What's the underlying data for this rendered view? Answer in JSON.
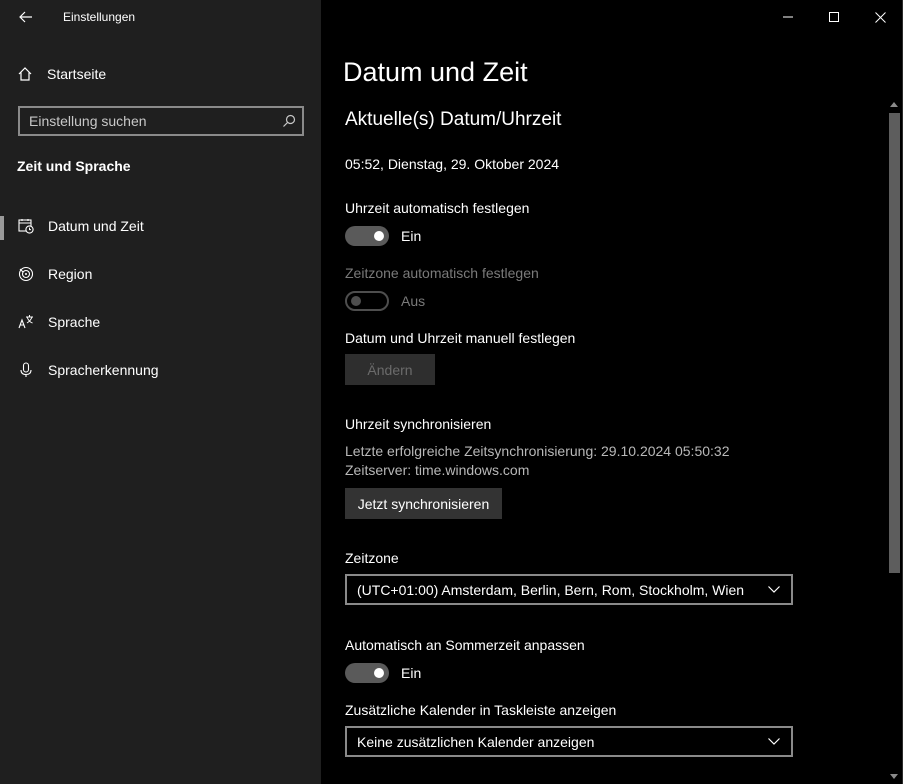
{
  "window": {
    "title": "Einstellungen"
  },
  "sidebar": {
    "home_label": "Startseite",
    "search_placeholder": "Einstellung suchen",
    "section_title": "Zeit und Sprache",
    "items": [
      {
        "label": "Datum und Zeit",
        "icon": "calendar-clock-icon",
        "selected": true
      },
      {
        "label": "Region",
        "icon": "globe-icon",
        "selected": false
      },
      {
        "label": "Sprache",
        "icon": "language-icon",
        "selected": false
      },
      {
        "label": "Spracherkennung",
        "icon": "microphone-icon",
        "selected": false
      }
    ]
  },
  "main": {
    "page_title": "Datum und Zeit",
    "subtitle": "Aktuelle(s) Datum/Uhrzeit",
    "current_datetime": "05:52, Dienstag, 29. Oktober 2024",
    "auto_time": {
      "label": "Uhrzeit automatisch festlegen",
      "state": "Ein",
      "on": true
    },
    "auto_timezone": {
      "label": "Zeitzone automatisch festlegen",
      "state": "Aus",
      "on": false,
      "disabled": true
    },
    "manual": {
      "label": "Datum und Uhrzeit manuell festlegen",
      "button": "Ändern"
    },
    "sync": {
      "title": "Uhrzeit synchronisieren",
      "last_sync": "Letzte erfolgreiche Zeitsynchronisierung: 29.10.2024 05:50:32",
      "server": "Zeitserver: time.windows.com",
      "button": "Jetzt synchronisieren"
    },
    "timezone": {
      "label": "Zeitzone",
      "value": "(UTC+01:00) Amsterdam, Berlin, Bern, Rom, Stockholm, Wien"
    },
    "dst": {
      "label": "Automatisch an Sommerzeit anpassen",
      "state": "Ein",
      "on": true
    },
    "calendar": {
      "label": "Zusätzliche Kalender in Taskleiste anzeigen",
      "value": "Keine zusätzlichen Kalender anzeigen"
    }
  },
  "colors": {
    "sidebar_bg": "#1f1f1f",
    "main_bg": "#000000",
    "accent_indicator": "#9a9a9a"
  }
}
